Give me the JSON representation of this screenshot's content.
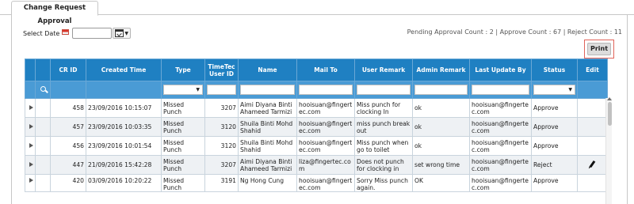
{
  "tab": {
    "title": "Change Request Approval"
  },
  "filter": {
    "select_date_label": "Select Date",
    "date_value": ""
  },
  "counts": "Pending Approval Count : 2 | Approve Count : 67 | Reject Count : 11",
  "toolbar": {
    "print_label": "Print"
  },
  "columns": [
    "CR ID",
    "Created Time",
    "Type",
    "TimeTec User ID",
    "Name",
    "Mail To",
    "User Remark",
    "Admin Remark",
    "Last Update By",
    "Status",
    "Edit"
  ],
  "rows": [
    {
      "cr_id": "458",
      "created": "23/09/2016 10:15:07",
      "type": "Missed Punch",
      "user_id": "3207",
      "name": "Aimi Diyana Binti Ahameed Tarmizi",
      "mail_to": "hooisuan@fingertec.com",
      "user_remark": "Miss punch for clocking In",
      "admin_remark": "ok",
      "updated_by": "hooisuan@fingertec.com",
      "status": "Approve"
    },
    {
      "cr_id": "457",
      "created": "23/09/2016 10:03:35",
      "type": "Missed Punch",
      "user_id": "3120",
      "name": "Shuila Binti Mohd Shahid",
      "mail_to": "hooisuan@fingertec.com",
      "user_remark": "miss punch break out",
      "admin_remark": "ok",
      "updated_by": "hooisuan@fingertec.com",
      "status": "Approve"
    },
    {
      "cr_id": "456",
      "created": "23/09/2016 10:01:54",
      "type": "Missed Punch",
      "user_id": "3120",
      "name": "Shuila Binti Mohd Shahid",
      "mail_to": "hooisuan@fingertec.com",
      "user_remark": "Miss punch when go to toilet",
      "admin_remark": "ok",
      "updated_by": "hooisuan@fingertec.com",
      "status": "Approve"
    },
    {
      "cr_id": "447",
      "created": "21/09/2016 15:42:28",
      "type": "Missed Punch",
      "user_id": "3207",
      "name": "Aimi Diyana Binti Ahameed Tarmizi",
      "mail_to": "liza@fingertec.com",
      "user_remark": "Does not punch for clocking in",
      "admin_remark": "set wrong time",
      "updated_by": "hooisuan@fingertec.com",
      "status": "Reject"
    },
    {
      "cr_id": "420",
      "created": "03/09/2016 10:20:22",
      "type": "Missed Punch",
      "user_id": "3191",
      "name": "Ng Hong Cung",
      "mail_to": "hooisuan@fingertec.com",
      "user_remark": "Sorry Miss punch again.",
      "admin_remark": "OK",
      "updated_by": "hooisuan@fingertec.com",
      "status": "Approve"
    }
  ],
  "icons": {
    "search": "search-icon",
    "edit": "pencil-icon",
    "calendar": "calendar-icon",
    "flag": "flag-icon"
  },
  "colors": {
    "header_bg": "#1f80c2",
    "filter_bg": "#4a9bd5",
    "print_highlight": "#e0645a"
  }
}
